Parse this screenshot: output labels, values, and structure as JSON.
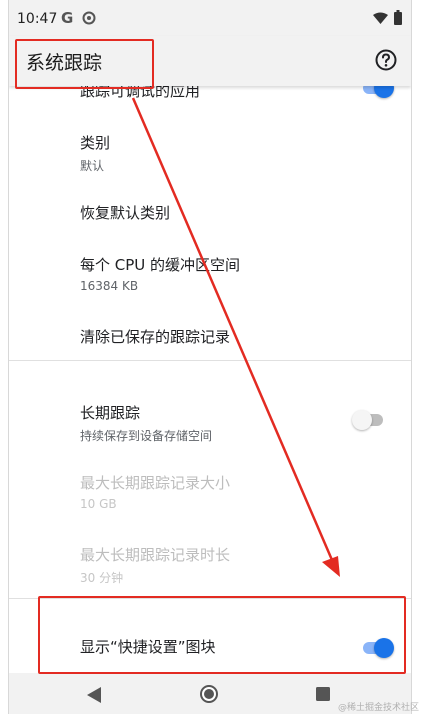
{
  "status_bar": {
    "time": "10:47",
    "g_glyph": "G",
    "icons": [
      "google-icon",
      "do-not-disturb-icon",
      "wifi-icon",
      "battery-icon"
    ]
  },
  "app_bar": {
    "title": "系统跟踪",
    "help_icon": "help-circle-icon"
  },
  "settings": {
    "trace_debuggable_apps": {
      "title": "跟踪可调试的应用",
      "enabled": true
    },
    "categories": {
      "title": "类别",
      "summary": "默认"
    },
    "restore_default_categories": {
      "title": "恢复默认类别"
    },
    "buffer_size": {
      "title": "每个 CPU 的缓冲区空间",
      "summary": "16384 KB"
    },
    "clear_saved_traces": {
      "title": "清除已保存的跟踪记录"
    },
    "long_traces": {
      "title": "长期跟踪",
      "summary": "持续保存到设备存储空间",
      "enabled": false
    },
    "max_long_trace_size": {
      "title": "最大长期跟踪记录大小",
      "summary": "10 GB",
      "disabled": true
    },
    "max_long_trace_duration": {
      "title": "最大长期跟踪记录时长",
      "summary": "30 分钟",
      "disabled": true
    },
    "show_quick_settings_tile": {
      "title": "显示“快捷设置”图块",
      "enabled": true
    }
  },
  "nav_bar": {
    "icons": [
      "back-icon",
      "home-icon",
      "recents-icon"
    ]
  },
  "watermark": "@稀土掘金技术社区",
  "colors": {
    "accent": "#1a73e8",
    "annotation": "#e32b22",
    "bar_bg": "#f2f2f2"
  }
}
